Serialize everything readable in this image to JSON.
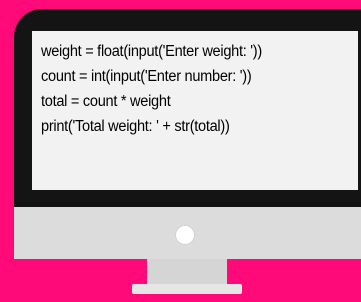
{
  "colors": {
    "background": "#ff0a78",
    "bezel": "#141414",
    "screen": "#f2f2f2",
    "chin": "#dcdcdc",
    "stand": "#d5d5d5",
    "power_button": "#ffffff",
    "code_text": "#000000"
  },
  "screen": {
    "code_lines": [
      "weight = float(input('Enter weight: '))",
      "count = int(input('Enter number: '))",
      "total = count * weight",
      "print('Total weight: ' + str(total))"
    ]
  },
  "icons": {
    "power_button": "power-button-icon"
  }
}
